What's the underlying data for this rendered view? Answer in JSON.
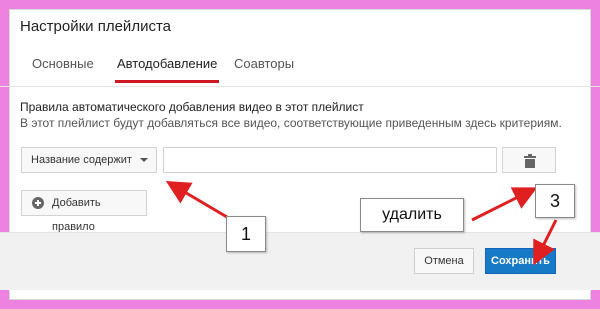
{
  "dialog": {
    "title": "Настройки плейлиста",
    "tabs": [
      {
        "label": "Основные",
        "active": false
      },
      {
        "label": "Автодобавление",
        "active": true
      },
      {
        "label": "Соавторы",
        "active": false
      }
    ]
  },
  "rules": {
    "heading": "Правила автоматического добавления видео в этот плейлист",
    "description": "В этот плейлист будут добавляться все видео, соответствующие приведенным здесь критериям.",
    "condition_select": "Название содержит",
    "condition_value": "",
    "add_rule_label": "Добавить правило"
  },
  "footer": {
    "cancel_label": "Отмена",
    "save_label": "Сохранить"
  },
  "annotations": {
    "label_1": "1",
    "label_delete": "удалить",
    "label_3": "3"
  },
  "icons": {
    "trash": "trash-icon",
    "add": "plus-circle-icon",
    "dropdown": "chevron-down-icon"
  },
  "colors": {
    "background": "#ee82e0",
    "active_tab_underline": "#cc181e",
    "save_button": "#167ac6",
    "annotation_arrow": "#e02020"
  }
}
